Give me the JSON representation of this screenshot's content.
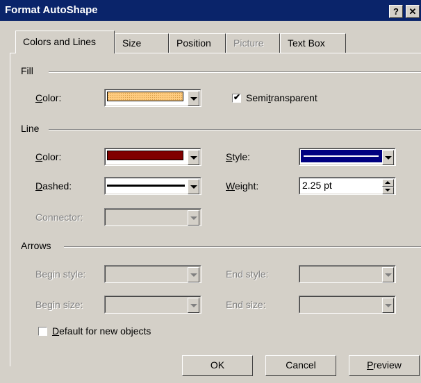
{
  "window": {
    "title": "Format AutoShape",
    "help_glyph": "?",
    "close_glyph": "✕"
  },
  "tabs": [
    {
      "label": "Colors and Lines",
      "active": true
    },
    {
      "label": "Size"
    },
    {
      "label": "Position"
    },
    {
      "label": "Picture",
      "disabled": true
    },
    {
      "label": "Text Box"
    }
  ],
  "fill": {
    "group": "Fill",
    "color_label_u": "C",
    "color_label_rest": "olor:",
    "color_value": "#ffcc80",
    "semi_pre": "Semi",
    "semi_u": "t",
    "semi_post": "ransparent",
    "semitransparent": true
  },
  "line": {
    "group": "Line",
    "color_label_u": "C",
    "color_label_rest": "olor:",
    "color_value": "#800000",
    "style_label_u": "S",
    "style_label_rest": "tyle:",
    "dashed_label_u": "D",
    "dashed_label_rest": "ashed:",
    "weight_label_u": "W",
    "weight_label_rest": "eight:",
    "weight_value": "2.25 pt",
    "connector_label": "Connector:"
  },
  "arrows": {
    "group": "Arrows",
    "begin_style": "Begin style:",
    "end_style": "End style:",
    "begin_size": "Begin size:",
    "end_size": "End size:"
  },
  "default_check": {
    "pre": "",
    "u": "D",
    "post": "efault for new objects",
    "checked": false
  },
  "buttons": {
    "ok": "OK",
    "cancel": "Cancel",
    "preview_u": "P",
    "preview_rest": "review"
  },
  "colors": {
    "titlebar": "#0a246a",
    "face": "#d4d0c8",
    "style_selected": "#000080"
  },
  "icons": {
    "check": "✔",
    "dropdown": "chevron-down-icon",
    "spin": "spin-arrows-icon"
  }
}
